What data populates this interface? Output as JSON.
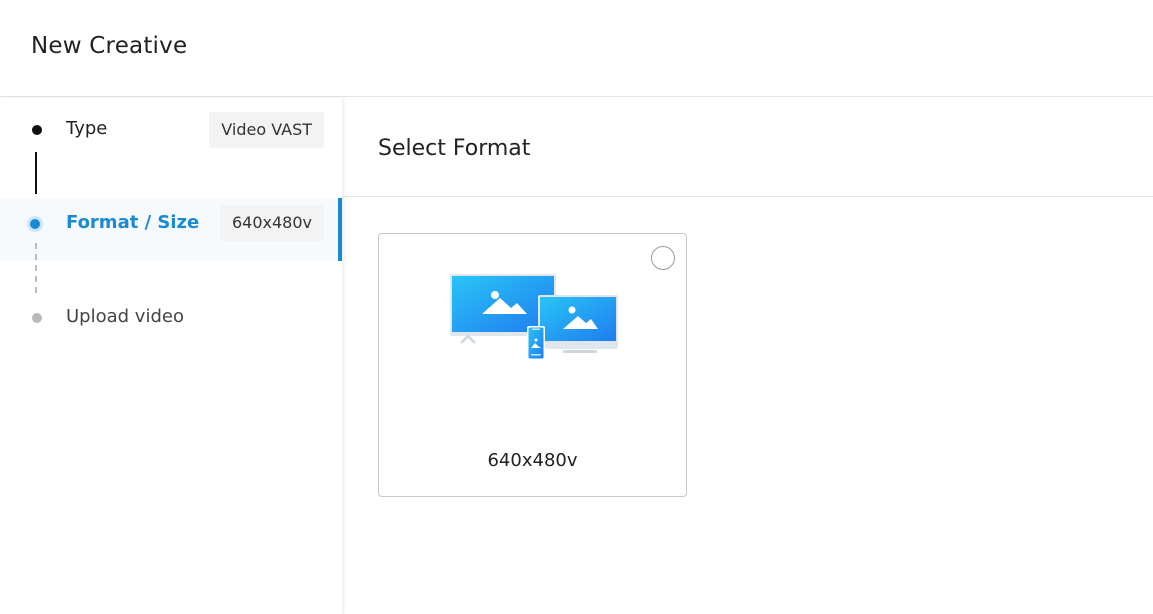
{
  "header": {
    "title": "New Creative"
  },
  "steps": [
    {
      "label": "Type",
      "value": "Video VAST",
      "state": "done"
    },
    {
      "label": "Format / Size",
      "value": "640x480v",
      "state": "active"
    },
    {
      "label": "Upload video",
      "value": "",
      "state": "pending"
    }
  ],
  "main": {
    "section_title": "Select Format",
    "formats": [
      {
        "label": "640x480v",
        "selected": false,
        "icon": "multi-device-icon"
      }
    ]
  },
  "colors": {
    "accent": "#1a8ad4",
    "active_bg": "#f7fafd",
    "done_dot": "#111111",
    "pending_dot": "#b9b9b9",
    "illustration_blue": "#1e90ff"
  }
}
